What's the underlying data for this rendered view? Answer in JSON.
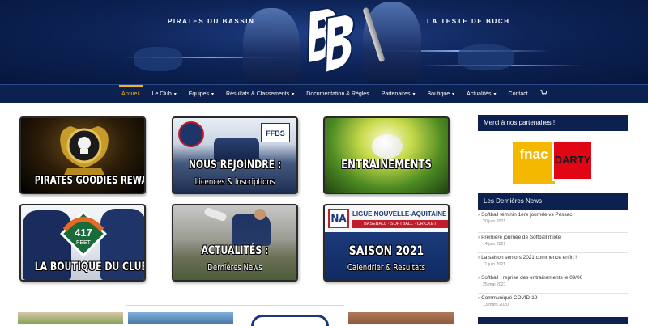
{
  "header": {
    "left_text": "PIRATES DU BASSIN",
    "right_text": "LA TESTE DE BUCH",
    "logo_icon": "pb-monogram-logo-icon"
  },
  "nav": {
    "items": [
      {
        "label": "Accueil",
        "has_dropdown": false,
        "active": true
      },
      {
        "label": "Le Club",
        "has_dropdown": true
      },
      {
        "label": "Equipes",
        "has_dropdown": true
      },
      {
        "label": "Résultats & Classements",
        "has_dropdown": true
      },
      {
        "label": "Documentation & Règles",
        "has_dropdown": false
      },
      {
        "label": "Partenaires",
        "has_dropdown": true
      },
      {
        "label": "Boutique",
        "has_dropdown": true
      },
      {
        "label": "Actualités",
        "has_dropdown": true
      },
      {
        "label": "Contact",
        "has_dropdown": false
      }
    ],
    "cart_icon": "cart-icon",
    "active_color": "#f1b31c",
    "bar_color": "#0d2150"
  },
  "tiles": [
    {
      "line1": "PIRATES GOODIES REWARDS",
      "line2": ""
    },
    {
      "line1": "NOUS REJOINDRE :",
      "line2": "Licences & Inscriptions",
      "badge": "FFBS"
    },
    {
      "line1": "ENTRAINEMENTS",
      "line2": ""
    },
    {
      "line1": "LA BOUTIQUE DU CLUB",
      "line2": "",
      "badge_line1": "417",
      "badge_line2": "FEET"
    },
    {
      "line1": "ACTUALITÉS :",
      "line2": "Dernières News"
    },
    {
      "line1": "SAISON 2021",
      "line2": "Calendrier & Resultats",
      "league_title": "LIGUE NOUVELLE-AQUITAINE",
      "league_sub": "BASEBALL · SOFTBALL · CRICKET",
      "league_logo": "NA"
    }
  ],
  "sidebar": {
    "partners_heading": "Merci à nos partenaires !",
    "partner_logo_left": "fnac",
    "partner_logo_right": "DARTY",
    "news_heading": "Les Dernières News",
    "news": [
      {
        "title": "Softball féminin 1ère journée vs Pessac",
        "date": "20 juin 2021"
      },
      {
        "title": "Première journée de Softball mixte",
        "date": "14 juin 2021"
      },
      {
        "title": "La saison séniors 2021 commence enfin !",
        "date": "11 juin 2021"
      },
      {
        "title": "Softball : reprise des entrainements le 09/06",
        "date": "25 mai 2021"
      },
      {
        "title": "Communiqué COVID-19",
        "date": "13 mars 2020"
      }
    ]
  }
}
